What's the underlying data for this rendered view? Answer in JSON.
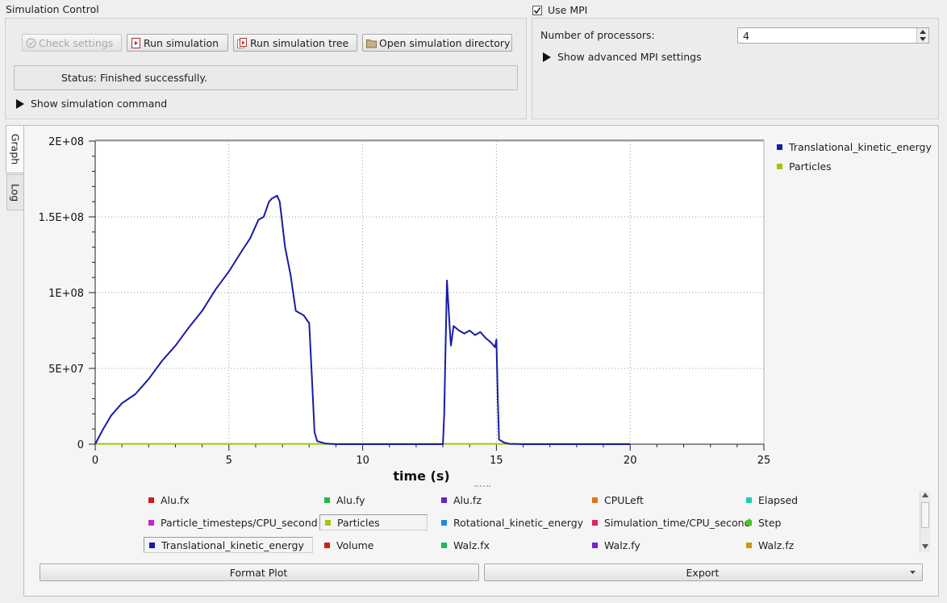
{
  "sim_control": {
    "title": "Simulation Control",
    "check_settings": "Check settings",
    "run_simulation": "Run simulation",
    "run_tree": "Run simulation tree",
    "open_dir": "Open simulation directory",
    "status": "Status: Finished successfully.",
    "show_command": "Show simulation command"
  },
  "mpi": {
    "use_mpi_label": "Use MPI",
    "use_mpi_checked": true,
    "num_proc_label": "Number of processors:",
    "num_proc_value": "4",
    "show_advanced": "Show advanced MPI settings"
  },
  "tabs": {
    "graph": "Graph",
    "log": "Log",
    "active": "Graph"
  },
  "chart_data": {
    "type": "line",
    "xlabel": "time (s)",
    "ylabel": "",
    "xlim": [
      0,
      25
    ],
    "ylim": [
      0,
      200000000
    ],
    "x_ticks": [
      "0",
      "5",
      "10",
      "15",
      "20",
      "25"
    ],
    "y_ticks": [
      "0",
      "5E+07",
      "1E+08",
      "1.5E+08",
      "2E+08"
    ],
    "grid": true,
    "legend_position": "right",
    "series": [
      {
        "name": "Translational_kinetic_energy",
        "color": "#1a1aa6",
        "points": [
          [
            0,
            0
          ],
          [
            0.3,
            10000000
          ],
          [
            0.6,
            19000000
          ],
          [
            1,
            27000000
          ],
          [
            1.5,
            33000000
          ],
          [
            2,
            43000000
          ],
          [
            2.5,
            55000000
          ],
          [
            3,
            65000000
          ],
          [
            3.5,
            77000000
          ],
          [
            4,
            88000000
          ],
          [
            4.5,
            102000000
          ],
          [
            5,
            114000000
          ],
          [
            5.5,
            128000000
          ],
          [
            5.8,
            136000000
          ],
          [
            6.1,
            148000000
          ],
          [
            6.3,
            150000000
          ],
          [
            6.5,
            160000000
          ],
          [
            6.6,
            162000000
          ],
          [
            6.8,
            164000000
          ],
          [
            6.9,
            160000000
          ],
          [
            7.0,
            145000000
          ],
          [
            7.1,
            130000000
          ],
          [
            7.3,
            112000000
          ],
          [
            7.5,
            88000000
          ],
          [
            7.8,
            85000000
          ],
          [
            7.95,
            81000000
          ],
          [
            8.0,
            80000000
          ],
          [
            8.1,
            45000000
          ],
          [
            8.2,
            8000000
          ],
          [
            8.3,
            2000000
          ],
          [
            8.6,
            500000
          ],
          [
            9,
            0
          ],
          [
            10,
            0
          ],
          [
            12,
            0
          ],
          [
            13.0,
            0
          ],
          [
            13.05,
            20000000
          ],
          [
            13.1,
            65000000
          ],
          [
            13.15,
            108000000
          ],
          [
            13.25,
            78000000
          ],
          [
            13.3,
            65000000
          ],
          [
            13.4,
            78000000
          ],
          [
            13.6,
            75000000
          ],
          [
            13.8,
            73000000
          ],
          [
            14.0,
            75000000
          ],
          [
            14.2,
            72000000
          ],
          [
            14.4,
            74000000
          ],
          [
            14.6,
            70000000
          ],
          [
            14.8,
            67000000
          ],
          [
            14.95,
            64000000
          ],
          [
            15.0,
            69000000
          ],
          [
            15.05,
            30000000
          ],
          [
            15.1,
            3000000
          ],
          [
            15.3,
            1000000
          ],
          [
            15.5,
            200000
          ],
          [
            16,
            0
          ],
          [
            18,
            0
          ],
          [
            20,
            0
          ]
        ]
      },
      {
        "name": "Particles",
        "color": "#a3c510",
        "points": [
          [
            0,
            200000
          ],
          [
            20,
            200000
          ]
        ]
      }
    ]
  },
  "plot_legend": [
    {
      "label": "Translational_kinetic_energy",
      "color": "#1a1aa6"
    },
    {
      "label": "Particles",
      "color": "#a3c510"
    }
  ],
  "variables": [
    {
      "label": "Alu.fx",
      "color": "#cc1f1f",
      "selected": false
    },
    {
      "label": "Alu.fy",
      "color": "#22bb44",
      "selected": false
    },
    {
      "label": "Alu.fz",
      "color": "#6622cc",
      "selected": false
    },
    {
      "label": "CPULeft",
      "color": "#dd7711",
      "selected": false
    },
    {
      "label": "Elapsed",
      "color": "#22ccaa",
      "selected": false
    },
    {
      "label": "Particle_timesteps/CPU_second",
      "color": "#cc22cc",
      "selected": false
    },
    {
      "label": "Particles",
      "color": "#a3c510",
      "selected": true
    },
    {
      "label": "Rotational_kinetic_energy",
      "color": "#2288dd",
      "selected": false
    },
    {
      "label": "Simulation_time/CPU_second",
      "color": "#dd2266",
      "selected": false
    },
    {
      "label": "Step",
      "color": "#44cc22",
      "selected": false
    },
    {
      "label": "Translational_kinetic_energy",
      "color": "#1a1aa6",
      "selected": true
    },
    {
      "label": "Volume",
      "color": "#cc2211",
      "selected": false
    },
    {
      "label": "Walz.fx",
      "color": "#22bb55",
      "selected": false
    },
    {
      "label": "Walz.fy",
      "color": "#7722cc",
      "selected": false
    },
    {
      "label": "Walz.fz",
      "color": "#cc9911",
      "selected": false
    }
  ],
  "bottom": {
    "format_plot": "Format Plot",
    "export": "Export"
  }
}
